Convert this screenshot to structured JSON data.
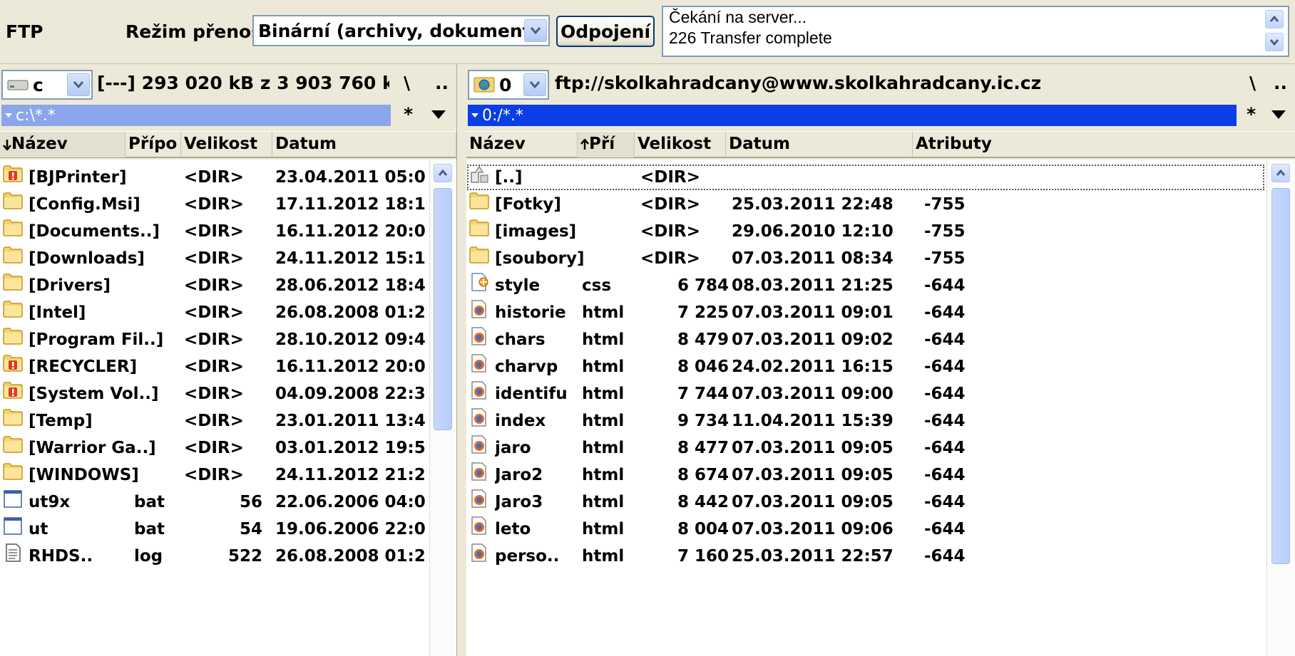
{
  "toolbar": {
    "ftp_label": "FTP",
    "mode_label": "Režim přenosu",
    "mode_value": "Binární (archivy, dokument",
    "disconnect_label": "Odpojení",
    "status_lines": [
      "Čekání na server...",
      "226 Transfer complete"
    ]
  },
  "left_panel": {
    "drive": "c",
    "free_space": "[---]  293 020 kB z 3 903 760 k",
    "root_btn": "\\",
    "up_btn": "..",
    "filter": "c:\\*.*",
    "star": "*",
    "columns": [
      "Název",
      "Přípo",
      "Velikost",
      "Datum"
    ],
    "sort_col": "Název",
    "rows": [
      {
        "icon": "folder-warning-icon",
        "name": "[BJPrinter]",
        "ext": "",
        "size": "<DIR>",
        "date": "23.04.2011 05:0"
      },
      {
        "icon": "folder-icon",
        "name": "[Config.Msi]",
        "ext": "",
        "size": "<DIR>",
        "date": "17.11.2012 18:1"
      },
      {
        "icon": "folder-icon",
        "name": "[Documents..]",
        "ext": "",
        "size": "<DIR>",
        "date": "16.11.2012 20:0"
      },
      {
        "icon": "folder-icon",
        "name": "[Downloads]",
        "ext": "",
        "size": "<DIR>",
        "date": "24.11.2012 15:1"
      },
      {
        "icon": "folder-icon",
        "name": "[Drivers]",
        "ext": "",
        "size": "<DIR>",
        "date": "28.06.2012 18:4"
      },
      {
        "icon": "folder-icon",
        "name": "[Intel]",
        "ext": "",
        "size": "<DIR>",
        "date": "26.08.2008 01:2"
      },
      {
        "icon": "folder-icon",
        "name": "[Program Fil..]",
        "ext": "",
        "size": "<DIR>",
        "date": "28.10.2012 09:4"
      },
      {
        "icon": "folder-warning-icon",
        "name": "[RECYCLER]",
        "ext": "",
        "size": "<DIR>",
        "date": "16.11.2012 20:0"
      },
      {
        "icon": "folder-warning-icon",
        "name": "[System Vol..]",
        "ext": "",
        "size": "<DIR>",
        "date": "04.09.2008 22:3"
      },
      {
        "icon": "folder-icon",
        "name": "[Temp]",
        "ext": "",
        "size": "<DIR>",
        "date": "23.01.2011 13:4"
      },
      {
        "icon": "folder-icon",
        "name": "[Warrior Ga..]",
        "ext": "",
        "size": "<DIR>",
        "date": "03.01.2012 19:5"
      },
      {
        "icon": "folder-icon",
        "name": "[WINDOWS]",
        "ext": "",
        "size": "<DIR>",
        "date": "24.11.2012 21:2"
      },
      {
        "icon": "batch-file-icon",
        "name": "ut9x",
        "ext": "bat",
        "size": "56",
        "date": "22.06.2006 04:0"
      },
      {
        "icon": "batch-file-icon",
        "name": "ut",
        "ext": "bat",
        "size": "54",
        "date": "19.06.2006 22:0"
      },
      {
        "icon": "text-file-icon",
        "name": "RHDS..",
        "ext": "log",
        "size": "522",
        "date": "26.08.2008 01:2"
      }
    ]
  },
  "right_panel": {
    "drive": "0",
    "address": "ftp://skolkahradcany@www.skolkahradcany.ic.cz",
    "root_btn": "\\",
    "up_btn": "..",
    "filter": "0:/*.*",
    "star": "*",
    "columns": [
      "Název",
      "Pří",
      "Velikost",
      "Datum",
      "Atributy"
    ],
    "sort_col": "Pří",
    "rows": [
      {
        "icon": "parent-dir-icon",
        "name": "[..]",
        "ext": "",
        "size": "<DIR>",
        "date": "",
        "attr": ""
      },
      {
        "icon": "folder-icon",
        "name": "[Fotky]",
        "ext": "",
        "size": "<DIR>",
        "date": "25.03.2011 22:48",
        "attr": "-755"
      },
      {
        "icon": "folder-icon",
        "name": "[images]",
        "ext": "",
        "size": "<DIR>",
        "date": "29.06.2010 12:10",
        "attr": "-755"
      },
      {
        "icon": "folder-icon",
        "name": "[soubory]",
        "ext": "",
        "size": "<DIR>",
        "date": "07.03.2011 08:34",
        "attr": "-755"
      },
      {
        "icon": "css-file-icon",
        "name": "style",
        "ext": "css",
        "size": "6 784",
        "date": "08.03.2011 21:25",
        "attr": "-644"
      },
      {
        "icon": "html-file-icon",
        "name": "historie",
        "ext": "html",
        "size": "7 225",
        "date": "07.03.2011 09:01",
        "attr": "-644"
      },
      {
        "icon": "html-file-icon",
        "name": "chars",
        "ext": "html",
        "size": "8 479",
        "date": "07.03.2011 09:02",
        "attr": "-644"
      },
      {
        "icon": "html-file-icon",
        "name": "charvp",
        "ext": "html",
        "size": "8 046",
        "date": "24.02.2011 16:15",
        "attr": "-644"
      },
      {
        "icon": "html-file-icon",
        "name": "identifu",
        "ext": "html",
        "size": "7 744",
        "date": "07.03.2011 09:00",
        "attr": "-644"
      },
      {
        "icon": "html-file-icon",
        "name": "index",
        "ext": "html",
        "size": "9 734",
        "date": "11.04.2011 15:39",
        "attr": "-644"
      },
      {
        "icon": "html-file-icon",
        "name": "jaro",
        "ext": "html",
        "size": "8 477",
        "date": "07.03.2011 09:05",
        "attr": "-644"
      },
      {
        "icon": "html-file-icon",
        "name": "Jaro2",
        "ext": "html",
        "size": "8 674",
        "date": "07.03.2011 09:05",
        "attr": "-644"
      },
      {
        "icon": "html-file-icon",
        "name": "Jaro3",
        "ext": "html",
        "size": "8 442",
        "date": "07.03.2011 09:05",
        "attr": "-644"
      },
      {
        "icon": "html-file-icon",
        "name": "leto",
        "ext": "html",
        "size": "8 004",
        "date": "07.03.2011 09:06",
        "attr": "-644"
      },
      {
        "icon": "html-file-icon",
        "name": "perso..",
        "ext": "html",
        "size": "7 160",
        "date": "25.03.2011 22:57",
        "attr": "-644"
      }
    ]
  },
  "colors": {
    "filter_left_inactive": "#8ba6ea",
    "filter_right_active": "#0a3ee6",
    "folder": "#f5d36a",
    "xp_border": "#7f9db9"
  }
}
